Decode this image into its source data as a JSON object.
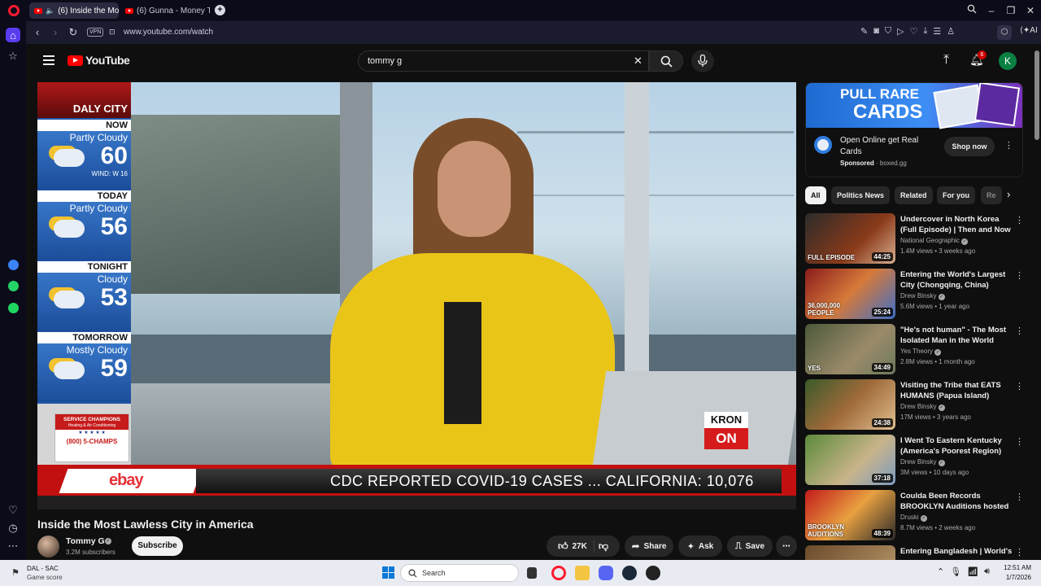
{
  "browser": {
    "tabs": [
      {
        "label": "(6) Inside the Most La"
      },
      {
        "label": "(6) Gunna - Money Talk [M"
      }
    ],
    "vpn_label": "VPN",
    "url": "www.youtube.com/watch",
    "ai_label": "AI"
  },
  "youtube": {
    "logo_text": "YouTube",
    "search_value": "tommy g",
    "notification_count": "6",
    "avatar_letter": "K"
  },
  "video": {
    "title": "Inside the Most Lawless City in America",
    "channel": "Tommy G",
    "subscribers": "3.2M subscribers",
    "subscribe_label": "Subscribe",
    "likes": "27K",
    "share_label": "Share",
    "ask_label": "Ask",
    "save_label": "Save",
    "overlay": {
      "city": "DALY CITY",
      "weather": [
        {
          "period": "NOW",
          "condition": "Partly Cloudy",
          "temp": "60",
          "extra": "WIND: W 16"
        },
        {
          "period": "TODAY",
          "condition": "Partly Cloudy",
          "temp": "56",
          "extra": ""
        },
        {
          "period": "TONIGHT",
          "condition": "Cloudy",
          "temp": "53",
          "extra": ""
        },
        {
          "period": "TOMORROW",
          "condition": "Mostly Cloudy",
          "temp": "59",
          "extra": ""
        }
      ],
      "sponsor_name": "SERVICE CHAMPIONS",
      "sponsor_sub": "Heating & Air Conditioning",
      "sponsor_phone": "(800) 5-CHAMPS",
      "ticker_brand": "ebay",
      "ticker_text": "CDC REPORTED COVID-19 CASES ... CALIFORNIA: 10,076",
      "station_top": "KRON",
      "station_bottom": "ON"
    }
  },
  "ad": {
    "banner_line1": "PULL RARE",
    "banner_line2": "CARDS",
    "title": "Open Online get Real Cards",
    "sponsored": "Sponsored",
    "domain": "boxed.gg",
    "cta": "Shop now"
  },
  "chips": [
    "All",
    "Politics News",
    "Related",
    "For you",
    "Re"
  ],
  "recommendations": [
    {
      "title": "Undercover in North Korea (Full Episode) | Then and Now with ...",
      "channel": "National Geographic",
      "meta": "1.4M views • 3 weeks ago",
      "duration": "44:25",
      "thumb_text": "FULL EPISODE"
    },
    {
      "title": "Entering the World's Largest City (Chongqing, China)",
      "channel": "Drew Binsky",
      "meta": "5.6M views • 1 year ago",
      "duration": "25:24",
      "thumb_text": "36,000,000 PEOPLE"
    },
    {
      "title": "\"He's not human\" - The Most Isolated Man in the World",
      "channel": "Yes Theory",
      "meta": "2.8M views • 1 month ago",
      "duration": "34:49",
      "thumb_text": "YES"
    },
    {
      "title": "Visiting the Tribe that EATS HUMANS (Papua Island)",
      "channel": "Drew Binsky",
      "meta": "17M views • 3 years ago",
      "duration": "24:38",
      "thumb_text": ""
    },
    {
      "title": "I Went To Eastern Kentucky (America's Poorest Region)",
      "channel": "Drew Binsky",
      "meta": "3M views • 10 days ago",
      "duration": "37:18",
      "thumb_text": ""
    },
    {
      "title": "Coulda Been Records BROOKLYN Auditions hosted b...",
      "channel": "Druski",
      "meta": "8.7M views • 2 weeks ago",
      "duration": "48:39",
      "thumb_text": "BROOKLYN AUDITIONS"
    },
    {
      "title": "Entering Bangladesh | World's",
      "channel": "",
      "meta": "",
      "duration": "",
      "thumb_text": ""
    }
  ],
  "taskbar": {
    "widget_title": "DAL - SAC",
    "widget_sub": "Game score",
    "search_placeholder": "Search",
    "time": "12:51 AM",
    "date": "1/7/2026"
  }
}
